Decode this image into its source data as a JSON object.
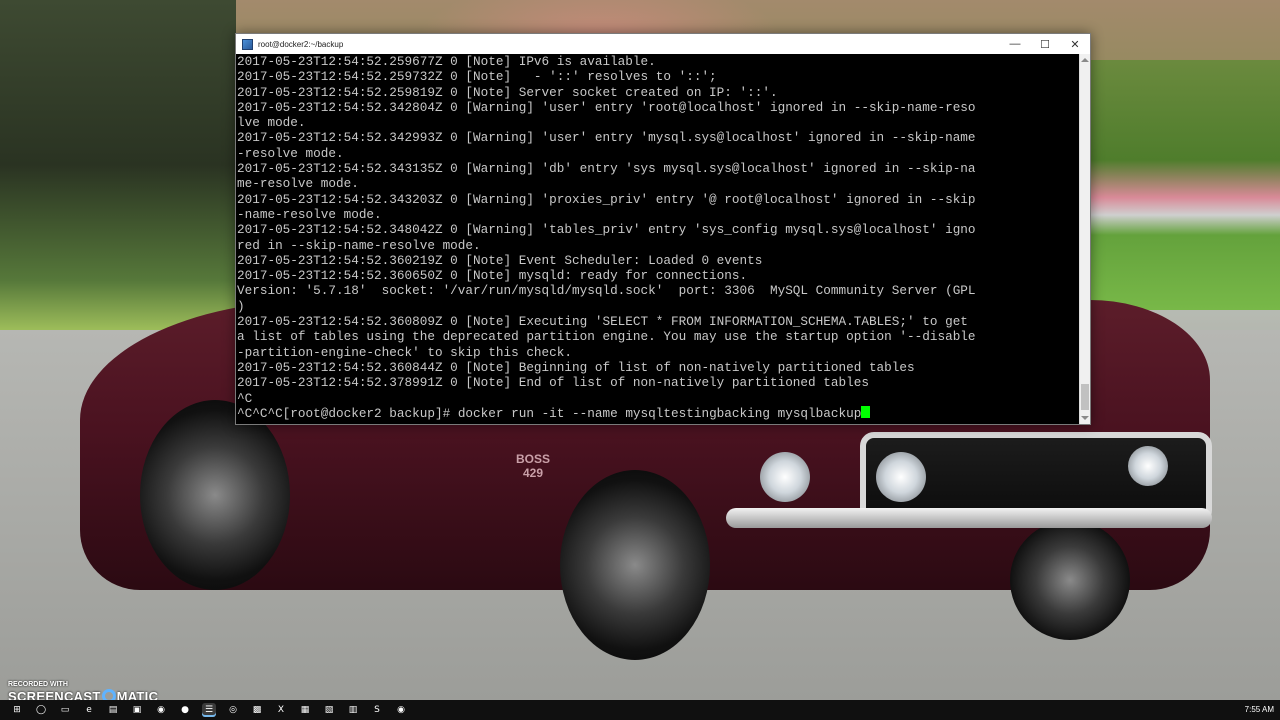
{
  "window": {
    "title": "root@docker2:~/backup",
    "controls": {
      "minimize": "—",
      "maximize": "☐",
      "close": "✕"
    }
  },
  "terminal": {
    "lines": [
      "2017-05-23T12:54:52.259677Z 0 [Note] IPv6 is available.",
      "2017-05-23T12:54:52.259732Z 0 [Note]   - '::' resolves to '::';",
      "2017-05-23T12:54:52.259819Z 0 [Note] Server socket created on IP: '::'.",
      "2017-05-23T12:54:52.342804Z 0 [Warning] 'user' entry 'root@localhost' ignored in --skip-name-reso",
      "lve mode.",
      "2017-05-23T12:54:52.342993Z 0 [Warning] 'user' entry 'mysql.sys@localhost' ignored in --skip-name",
      "-resolve mode.",
      "2017-05-23T12:54:52.343135Z 0 [Warning] 'db' entry 'sys mysql.sys@localhost' ignored in --skip-na",
      "me-resolve mode.",
      "2017-05-23T12:54:52.343203Z 0 [Warning] 'proxies_priv' entry '@ root@localhost' ignored in --skip",
      "-name-resolve mode.",
      "2017-05-23T12:54:52.348042Z 0 [Warning] 'tables_priv' entry 'sys_config mysql.sys@localhost' igno",
      "red in --skip-name-resolve mode.",
      "2017-05-23T12:54:52.360219Z 0 [Note] Event Scheduler: Loaded 0 events",
      "2017-05-23T12:54:52.360650Z 0 [Note] mysqld: ready for connections.",
      "Version: '5.7.18'  socket: '/var/run/mysqld/mysqld.sock'  port: 3306  MySQL Community Server (GPL",
      ")",
      "2017-05-23T12:54:52.360809Z 0 [Note] Executing 'SELECT * FROM INFORMATION_SCHEMA.TABLES;' to get",
      "a list of tables using the deprecated partition engine. You may use the startup option '--disable",
      "-partition-engine-check' to skip this check.",
      "2017-05-23T12:54:52.360844Z 0 [Note] Beginning of list of non-natively partitioned tables",
      "2017-05-23T12:54:52.378991Z 0 [Note] End of list of non-natively partitioned tables",
      "^C"
    ],
    "prompt": "^C^C^C[root@docker2 backup]# ",
    "command": "docker run -it --name mysqltestingbacking mysqlbackup",
    "cursor_color": "#00ff00"
  },
  "watermark": {
    "line1": "RECORDED WITH",
    "line2_left": "SCREENCAST",
    "line2_right": "MATIC"
  },
  "car": {
    "badge_line1": "BOSS",
    "badge_line2": "429"
  },
  "taskbar": {
    "icons": [
      {
        "name": "start-icon",
        "glyph": "⊞"
      },
      {
        "name": "search-icon",
        "glyph": "◯"
      },
      {
        "name": "task-view-icon",
        "glyph": "▭"
      },
      {
        "name": "edge-icon",
        "glyph": "e"
      },
      {
        "name": "file-explorer-icon",
        "glyph": "▤"
      },
      {
        "name": "store-icon",
        "glyph": "▣"
      },
      {
        "name": "chrome-icon",
        "glyph": "◉"
      },
      {
        "name": "firefox-icon",
        "glyph": "●"
      },
      {
        "name": "putty-icon",
        "glyph": "☰",
        "active": true
      },
      {
        "name": "app-icon-1",
        "glyph": "◎"
      },
      {
        "name": "app-icon-2",
        "glyph": "▩"
      },
      {
        "name": "excel-icon",
        "glyph": "X"
      },
      {
        "name": "app-icon-3",
        "glyph": "▦"
      },
      {
        "name": "app-icon-4",
        "glyph": "▧"
      },
      {
        "name": "app-icon-5",
        "glyph": "▥"
      },
      {
        "name": "skype-icon",
        "glyph": "S"
      },
      {
        "name": "chrome-icon-2",
        "glyph": "◉"
      }
    ],
    "clock": "7:55 AM"
  }
}
